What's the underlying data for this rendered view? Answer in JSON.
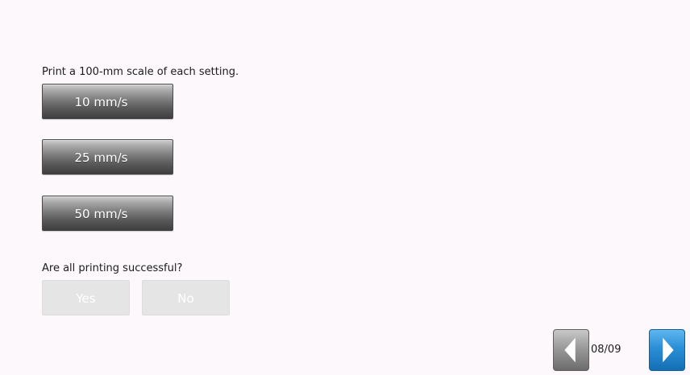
{
  "instruction": "Print a 100-mm scale of each setting.",
  "speed_buttons": [
    {
      "label": "10 mm/s"
    },
    {
      "label": "25 mm/s"
    },
    {
      "label": "50 mm/s"
    }
  ],
  "question": "Are all printing successful?",
  "answer_buttons": {
    "yes": "Yes",
    "no": "No"
  },
  "pager": {
    "indicator": "08/09",
    "prev_icon": "chevron-left-icon",
    "next_icon": "chevron-right-icon",
    "next_color": "#2a8fd7",
    "prev_color": "#8a8a8a"
  }
}
